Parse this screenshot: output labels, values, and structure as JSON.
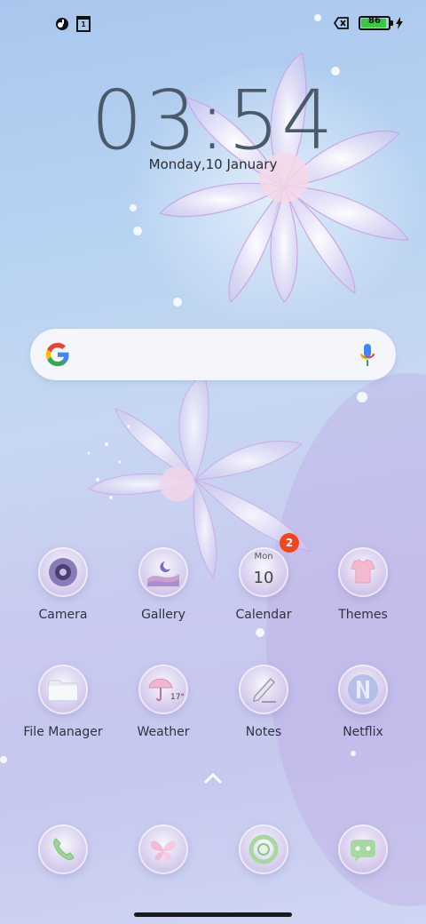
{
  "status_bar": {
    "left_icons": [
      "notification-app-icon",
      "calendar-notification-icon"
    ],
    "calendar_glyph": "1",
    "battery_level": "86",
    "charging": true,
    "sim_icon": "no-sim-icon"
  },
  "lockscreen": {
    "time": "03:54",
    "date": "Monday,10 January"
  },
  "search": {
    "icons": [
      "google-g-icon",
      "microphone-icon"
    ]
  },
  "apps": {
    "row1": [
      {
        "label": "Camera",
        "icon": "camera-icon"
      },
      {
        "label": "Gallery",
        "icon": "gallery-icon"
      },
      {
        "label": "Calendar",
        "icon": "calendar-icon",
        "day_name": "Mon",
        "day_num": "10",
        "badge": "2"
      },
      {
        "label": "Themes",
        "icon": "themes-icon"
      }
    ],
    "row2": [
      {
        "label": "File Manager",
        "icon": "folder-icon"
      },
      {
        "label": "Weather",
        "icon": "weather-umbrella-icon",
        "temp": "17°"
      },
      {
        "label": "Notes",
        "icon": "notes-pencil-icon"
      },
      {
        "label": "Netflix",
        "icon": "netflix-icon"
      }
    ],
    "dock": [
      {
        "icon": "phone-icon"
      },
      {
        "icon": "butterfly-icon"
      },
      {
        "icon": "chrome-icon"
      },
      {
        "icon": "messages-icon"
      }
    ]
  },
  "colors": {
    "badge": "#f2471d",
    "battery_fill": "#38c93f",
    "clock": "#4b5a6b"
  }
}
